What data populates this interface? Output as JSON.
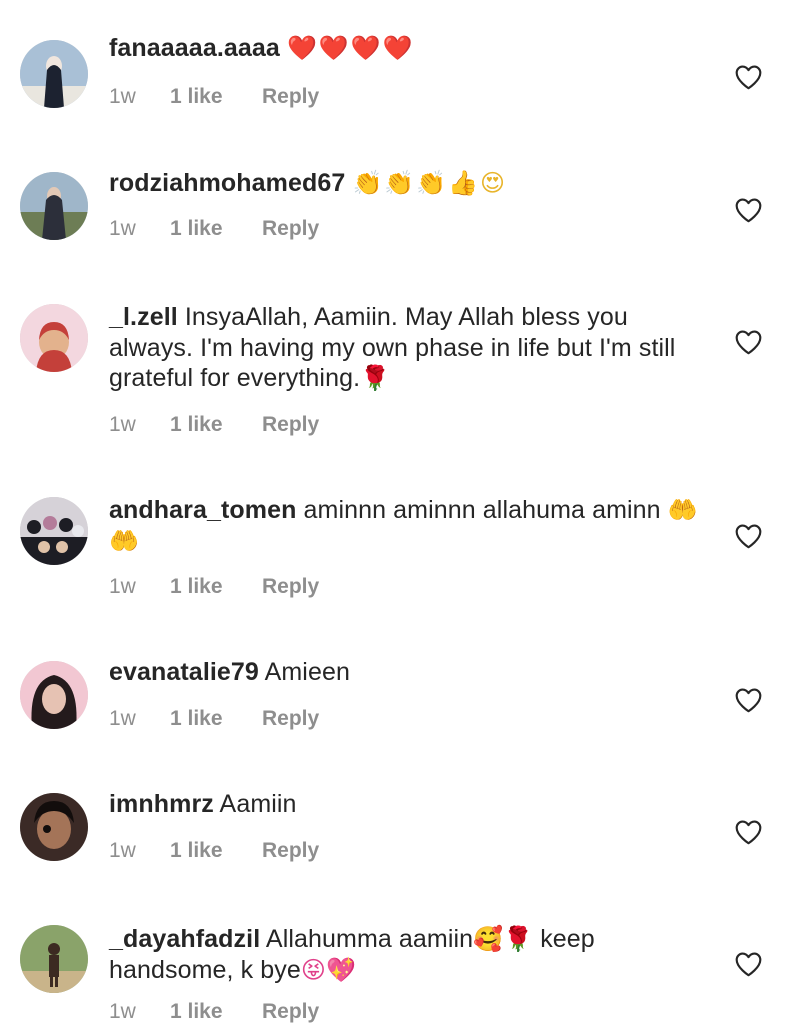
{
  "comments": [
    {
      "username": "fanaaaaa.aaaa",
      "text": "",
      "emoji": "❤️❤️❤️❤️",
      "time": "1w",
      "likes": "1 like",
      "reply": "Reply",
      "avatar_colors": [
        "#a9c0d6",
        "#1c2230",
        "#e9e6df"
      ]
    },
    {
      "username": "rodziahmohamed67",
      "text": "",
      "emoji": "👏👏👏👍😍",
      "time": "1w",
      "likes": "1 like",
      "reply": "Reply",
      "avatar_colors": [
        "#9fb6c9",
        "#2c2f3a",
        "#6d7d55"
      ]
    },
    {
      "username": "_l.zell",
      "text": "InsyaAllah, Aamiin. May Allah bless you always. I'm having my own phase in life but I'm still grateful for everything.",
      "emoji": "🌹",
      "time": "1w",
      "likes": "1 like",
      "reply": "Reply",
      "avatar_colors": [
        "#f3d7df",
        "#c4403a",
        "#e3b28d"
      ]
    },
    {
      "username": "andhara_tomen",
      "text": "aminnn  aminnn  allahuma aminn",
      "emoji": "🤲🤲",
      "time": "1w",
      "likes": "1 like",
      "reply": "Reply",
      "avatar_colors": [
        "#d6d2d8",
        "#1d1d24",
        "#b47c9a"
      ]
    },
    {
      "username": "evanatalie79",
      "text": "Amieen",
      "emoji": "",
      "time": "1w",
      "likes": "1 like",
      "reply": "Reply",
      "avatar_colors": [
        "#f2c7d2",
        "#241a1c",
        "#e6c2b3"
      ]
    },
    {
      "username": "imnhmrz",
      "text": "Aamiin",
      "emoji": "",
      "time": "1w",
      "likes": "1 like",
      "reply": "Reply",
      "avatar_colors": [
        "#3b2a26",
        "#120d0c",
        "#a47458"
      ]
    },
    {
      "username": "_dayahfadzil",
      "text": "Allahumma aamiin",
      "emoji": "🥰🌹",
      "text_after": "keep handsome, k bye",
      "emoji_end": "😝💖",
      "time": "1w",
      "likes": "1 like",
      "reply": "Reply",
      "avatar_colors": [
        "#8aa36a",
        "#3c2a22",
        "#c9b48a"
      ]
    }
  ],
  "icons": {
    "like": "heart-outline-icon"
  },
  "colors": {
    "meta": "#8e8e8e",
    "text": "#262626",
    "heart_stroke": "#262626"
  }
}
